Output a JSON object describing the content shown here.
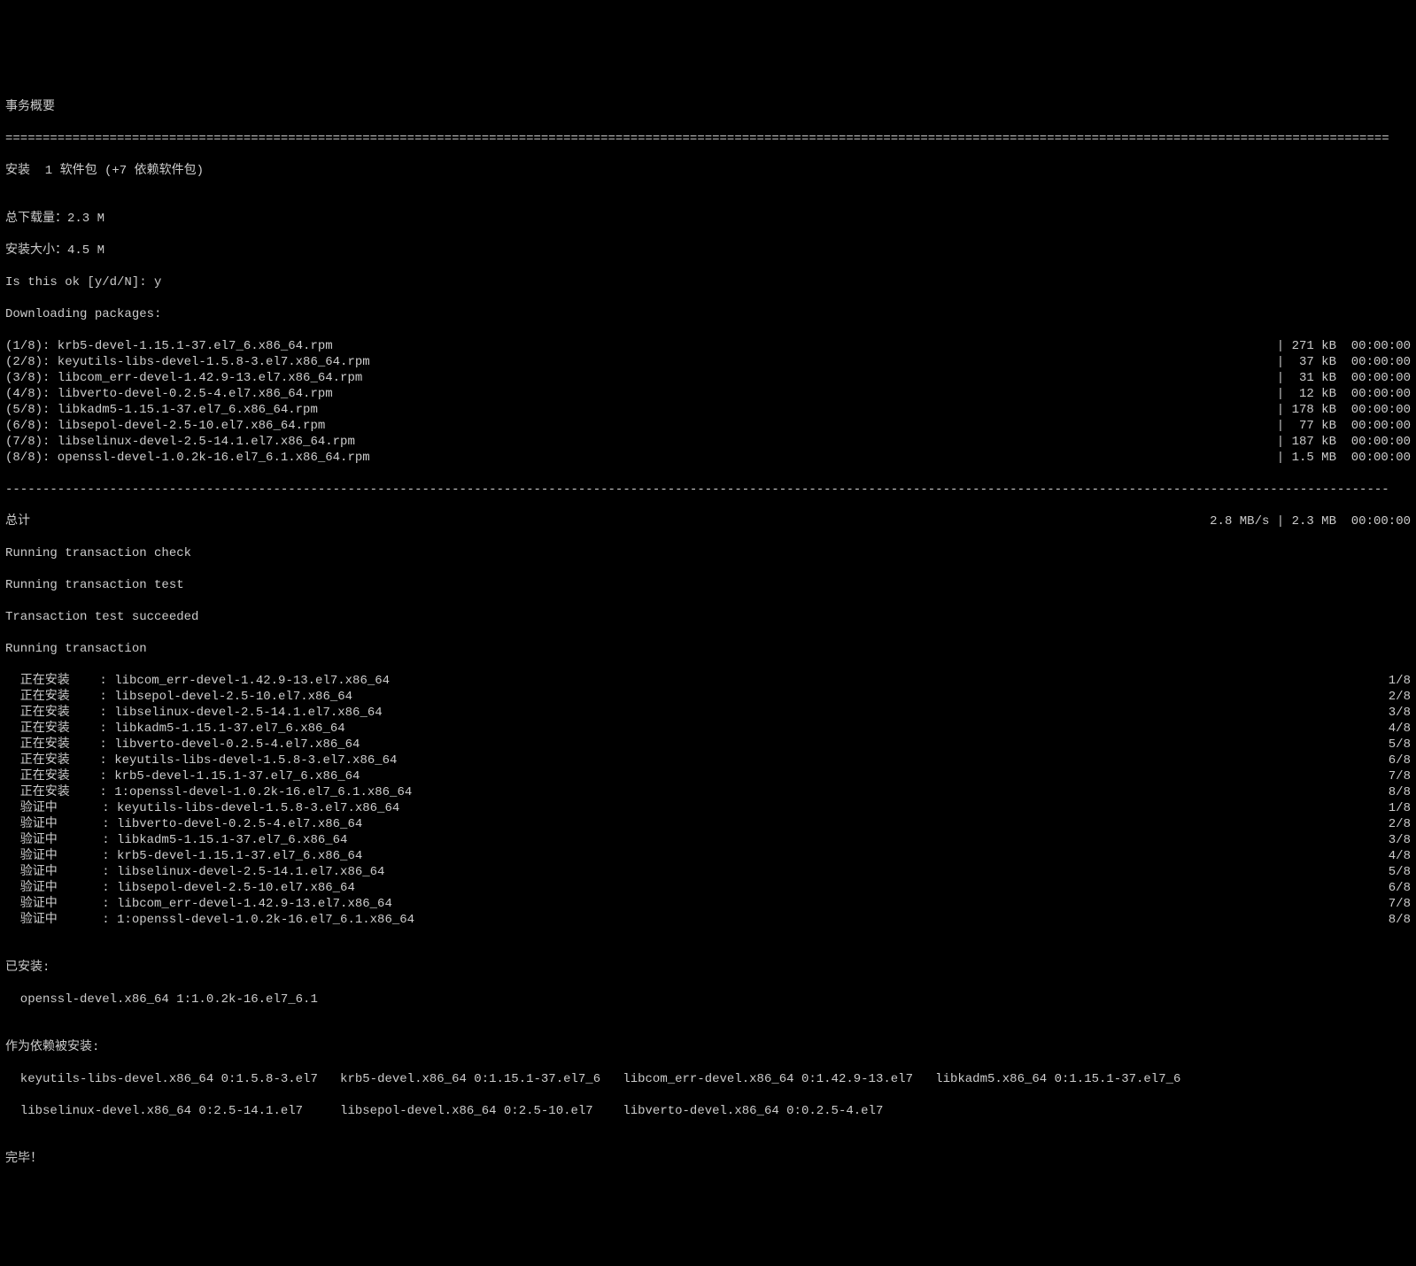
{
  "header": {
    "title": "事务概要",
    "separator": "==========================================================================================================================================================================================",
    "install_line": "安装  1 软件包 (+7 依赖软件包)",
    "blank": "",
    "total_download": "总下载量：2.3 M",
    "install_size": "安装大小：4.5 M",
    "confirm": "Is this ok [y/d/N]: y",
    "downloading": "Downloading packages:"
  },
  "downloads": [
    {
      "left": "(1/8): krb5-devel-1.15.1-37.el7_6.x86_64.rpm",
      "right": "| 271 kB  00:00:00"
    },
    {
      "left": "(2/8): keyutils-libs-devel-1.5.8-3.el7.x86_64.rpm",
      "right": "|  37 kB  00:00:00"
    },
    {
      "left": "(3/8): libcom_err-devel-1.42.9-13.el7.x86_64.rpm",
      "right": "|  31 kB  00:00:00"
    },
    {
      "left": "(4/8): libverto-devel-0.2.5-4.el7.x86_64.rpm",
      "right": "|  12 kB  00:00:00"
    },
    {
      "left": "(5/8): libkadm5-1.15.1-37.el7_6.x86_64.rpm",
      "right": "| 178 kB  00:00:00"
    },
    {
      "left": "(6/8): libsepol-devel-2.5-10.el7.x86_64.rpm",
      "right": "|  77 kB  00:00:00"
    },
    {
      "left": "(7/8): libselinux-devel-2.5-14.1.el7.x86_64.rpm",
      "right": "| 187 kB  00:00:00"
    },
    {
      "left": "(8/8): openssl-devel-1.0.2k-16.el7_6.1.x86_64.rpm",
      "right": "| 1.5 MB  00:00:00"
    }
  ],
  "dash_separator": "------------------------------------------------------------------------------------------------------------------------------------------------------------------------------------------",
  "total_row": {
    "left": "总计",
    "right": "2.8 MB/s | 2.3 MB  00:00:00"
  },
  "trans_check": "Running transaction check",
  "trans_test": "Running transaction test",
  "trans_succ": "Transaction test succeeded",
  "trans_run": "Running transaction",
  "install_steps": [
    {
      "left": "  正在安装    : libcom_err-devel-1.42.9-13.el7.x86_64",
      "right": "1/8"
    },
    {
      "left": "  正在安装    : libsepol-devel-2.5-10.el7.x86_64",
      "right": "2/8"
    },
    {
      "left": "  正在安装    : libselinux-devel-2.5-14.1.el7.x86_64",
      "right": "3/8"
    },
    {
      "left": "  正在安装    : libkadm5-1.15.1-37.el7_6.x86_64",
      "right": "4/8"
    },
    {
      "left": "  正在安装    : libverto-devel-0.2.5-4.el7.x86_64",
      "right": "5/8"
    },
    {
      "left": "  正在安装    : keyutils-libs-devel-1.5.8-3.el7.x86_64",
      "right": "6/8"
    },
    {
      "left": "  正在安装    : krb5-devel-1.15.1-37.el7_6.x86_64",
      "right": "7/8"
    },
    {
      "left": "  正在安装    : 1:openssl-devel-1.0.2k-16.el7_6.1.x86_64",
      "right": "8/8"
    },
    {
      "left": "  验证中      : keyutils-libs-devel-1.5.8-3.el7.x86_64",
      "right": "1/8"
    },
    {
      "left": "  验证中      : libverto-devel-0.2.5-4.el7.x86_64",
      "right": "2/8"
    },
    {
      "left": "  验证中      : libkadm5-1.15.1-37.el7_6.x86_64",
      "right": "3/8"
    },
    {
      "left": "  验证中      : krb5-devel-1.15.1-37.el7_6.x86_64",
      "right": "4/8"
    },
    {
      "left": "  验证中      : libselinux-devel-2.5-14.1.el7.x86_64",
      "right": "5/8"
    },
    {
      "left": "  验证中      : libsepol-devel-2.5-10.el7.x86_64",
      "right": "6/8"
    },
    {
      "left": "  验证中      : libcom_err-devel-1.42.9-13.el7.x86_64",
      "right": "7/8"
    },
    {
      "left": "  验证中      : 1:openssl-devel-1.0.2k-16.el7_6.1.x86_64",
      "right": "8/8"
    }
  ],
  "installed_header": "已安装:",
  "installed_pkg": "  openssl-devel.x86_64 1:1.0.2k-16.el7_6.1",
  "deps_header": "作为依赖被安装:",
  "deps_line1": "  keyutils-libs-devel.x86_64 0:1.5.8-3.el7   krb5-devel.x86_64 0:1.15.1-37.el7_6   libcom_err-devel.x86_64 0:1.42.9-13.el7   libkadm5.x86_64 0:1.15.1-37.el7_6",
  "deps_line2": "  libselinux-devel.x86_64 0:2.5-14.1.el7     libsepol-devel.x86_64 0:2.5-10.el7    libverto-devel.x86_64 0:0.2.5-4.el7",
  "done": "完毕！"
}
